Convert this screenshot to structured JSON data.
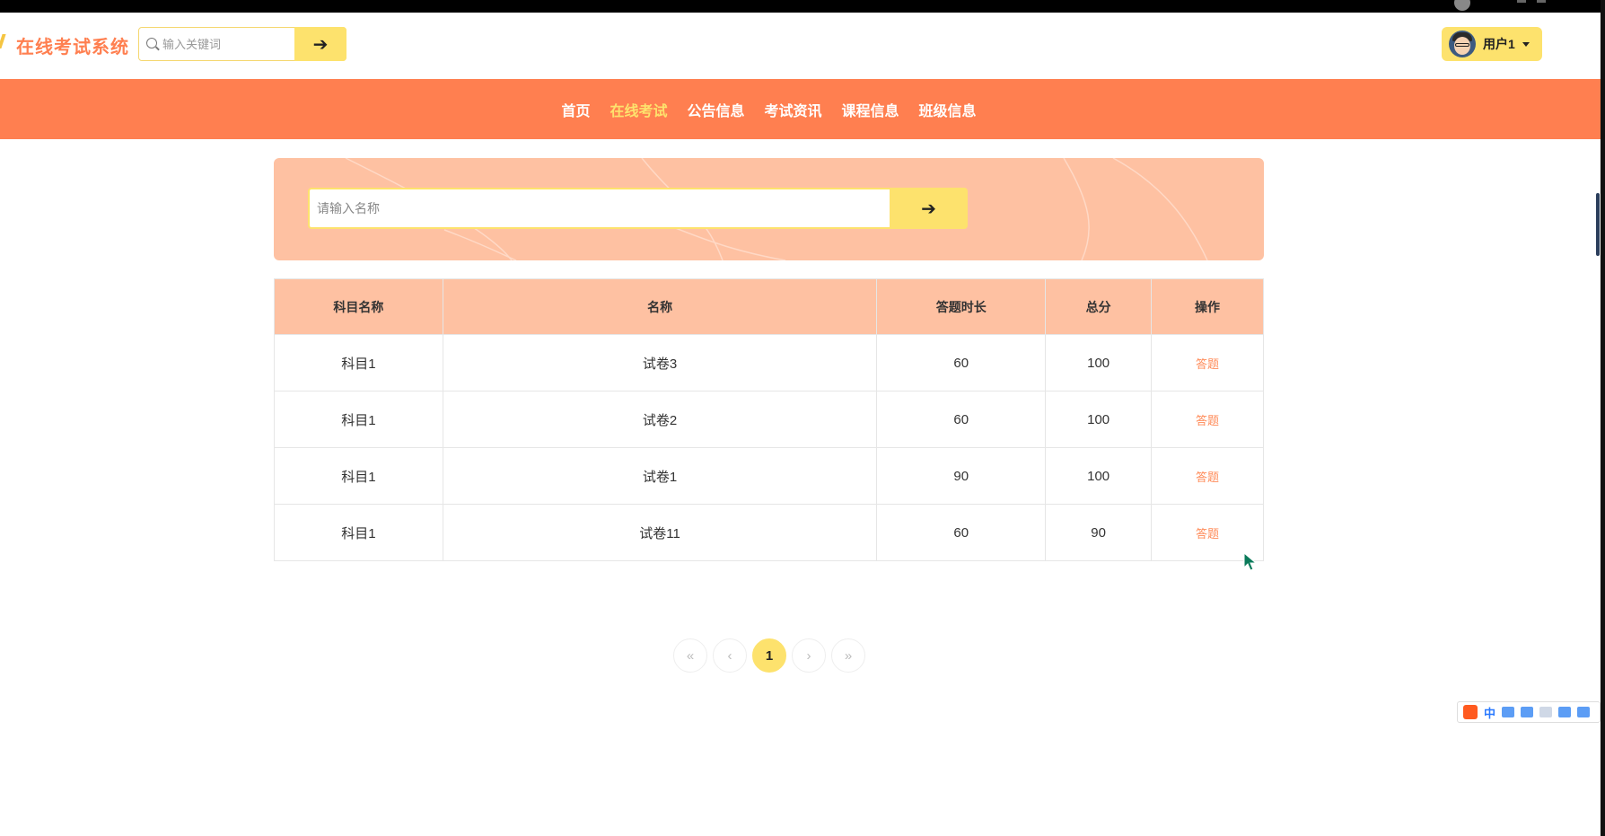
{
  "app": {
    "title": "在线考试系统"
  },
  "header": {
    "search_placeholder": "输入关键词",
    "search_button_icon": "arrow-right-icon",
    "user_name": "用户1"
  },
  "nav": {
    "items": [
      {
        "label": "首页",
        "active": false
      },
      {
        "label": "在线考试",
        "active": true
      },
      {
        "label": "公告信息",
        "active": false
      },
      {
        "label": "考试资讯",
        "active": false
      },
      {
        "label": "课程信息",
        "active": false
      },
      {
        "label": "班级信息",
        "active": false
      }
    ]
  },
  "search": {
    "placeholder": "请输入名称",
    "button_icon": "arrow-right-icon"
  },
  "table": {
    "headers": [
      "科目名称",
      "名称",
      "答题时长",
      "总分",
      "操作"
    ],
    "rows": [
      {
        "subject": "科目1",
        "name": "试卷3",
        "duration": "60",
        "score": "100",
        "action": "答题"
      },
      {
        "subject": "科目1",
        "name": "试卷2",
        "duration": "60",
        "score": "100",
        "action": "答题"
      },
      {
        "subject": "科目1",
        "name": "试卷1",
        "duration": "90",
        "score": "100",
        "action": "答题"
      },
      {
        "subject": "科目1",
        "name": "试卷11",
        "duration": "60",
        "score": "90",
        "action": "答题"
      }
    ]
  },
  "pagination": {
    "first": "«",
    "prev": "‹",
    "current": "1",
    "next": "›",
    "last": "»"
  },
  "ime": {
    "lang": "中"
  },
  "colors": {
    "brand": "#ff7f50",
    "accent": "#fde26d",
    "banner": "#fec1a2",
    "action_link": "#ff8c5a"
  }
}
